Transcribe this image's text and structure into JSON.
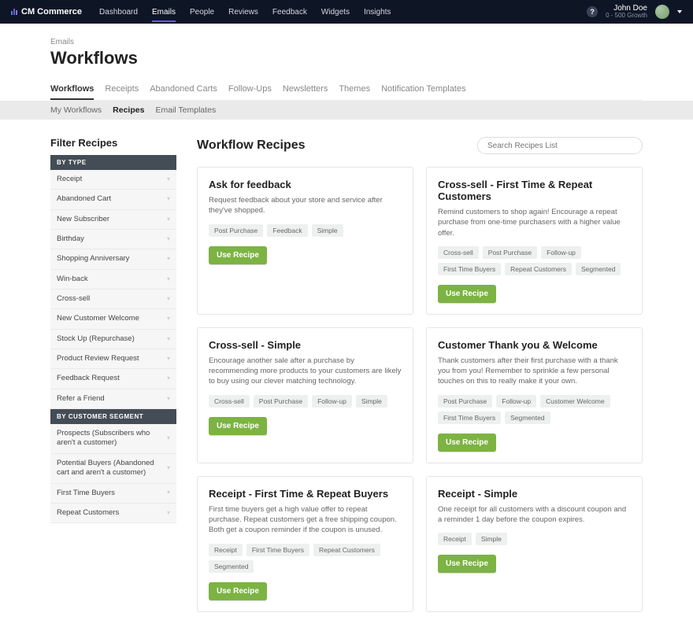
{
  "brand": "CM Commerce",
  "topnav": [
    "Dashboard",
    "Emails",
    "People",
    "Reviews",
    "Feedback",
    "Widgets",
    "Insights"
  ],
  "topnav_active": 1,
  "user": {
    "name": "John Doe",
    "plan": "0 - 500 Growth"
  },
  "breadcrumb": "Emails",
  "page_title": "Workflows",
  "tabs1": [
    "Workflows",
    "Receipts",
    "Abandoned Carts",
    "Follow-Ups",
    "Newsletters",
    "Themes",
    "Notification Templates"
  ],
  "tabs1_active": 0,
  "tabs2": [
    "My Workflows",
    "Recipes",
    "Email Templates"
  ],
  "tabs2_active": 1,
  "filter_title": "Filter Recipes",
  "filter_sections": [
    {
      "header": "BY TYPE",
      "items": [
        "Receipt",
        "Abandoned Cart",
        "New Subscriber",
        "Birthday",
        "Shopping Anniversary",
        "Win-back",
        "Cross-sell",
        "New Customer Welcome",
        "Stock Up (Repurchase)",
        "Product Review Request",
        "Feedback Request",
        "Refer a Friend"
      ]
    },
    {
      "header": "BY CUSTOMER SEGMENT",
      "items": [
        "Prospects (Subscribers who aren't a customer)",
        "Potential Buyers (Abandoned cart and aren't a customer)",
        "First Time Buyers",
        "Repeat Customers"
      ]
    }
  ],
  "main_heading": "Workflow Recipes",
  "search_placeholder": "Search Recipes List",
  "use_label": "Use Recipe",
  "recipes": [
    {
      "title": "Ask for feedback",
      "desc": "Request feedback about your store and service after they've shopped.",
      "tags": [
        "Post Purchase",
        "Feedback",
        "Simple"
      ]
    },
    {
      "title": "Cross-sell - First Time & Repeat Customers",
      "desc": "Remind customers to shop again! Encourage a repeat purchase from one-time purchasers with a higher value offer.",
      "tags": [
        "Cross-sell",
        "Post Purchase",
        "Follow-up",
        "First Time Buyers",
        "Repeat Customers",
        "Segmented"
      ]
    },
    {
      "title": "Cross-sell - Simple",
      "desc": "Encourage another sale after a purchase by recommending more products to your customers are likely to buy using our clever matching technology.",
      "tags": [
        "Cross-sell",
        "Post Purchase",
        "Follow-up",
        "Simple"
      ]
    },
    {
      "title": "Customer Thank you & Welcome",
      "desc": "Thank customers after their first purchase with a thank you from you! Remember to sprinkle a few personal touches on this to really make it your own.",
      "tags": [
        "Post Purchase",
        "Follow-up",
        "Customer Welcome",
        "First Time Buyers",
        "Segmented"
      ]
    },
    {
      "title": "Receipt - First Time & Repeat Buyers",
      "desc": "First time buyers get a high value offer to repeat purchase. Repeat customers get a free shipping coupon. Both get a coupon reminder if the coupon is unused.",
      "tags": [
        "Receipt",
        "First Time Buyers",
        "Repeat Customers",
        "Segmented"
      ]
    },
    {
      "title": "Receipt - Simple",
      "desc": "One receipt for all customers with a discount coupon and a reminder 1 day before the coupon expires.",
      "tags": [
        "Receipt",
        "Simple"
      ]
    }
  ]
}
